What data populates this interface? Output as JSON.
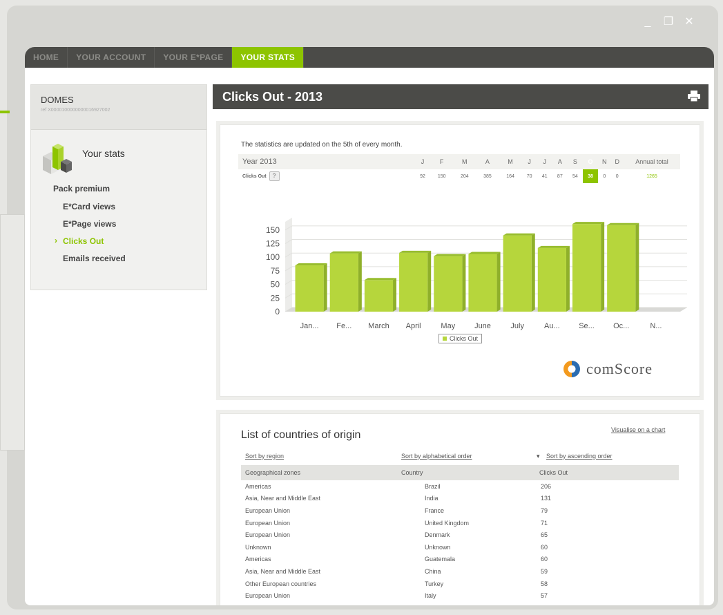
{
  "window_controls": {
    "minimize": "_",
    "restore": "❐",
    "close": "✕"
  },
  "nav": {
    "tabs": [
      {
        "label": "HOME",
        "active": false
      },
      {
        "label": "YOUR ACCOUNT",
        "active": false
      },
      {
        "label": "YOUR E*PAGE",
        "active": false
      },
      {
        "label": "YOUR STATS",
        "active": true
      }
    ]
  },
  "sidebar": {
    "name": "DOMES",
    "ref": "ref X0000100000000016927002",
    "title": "Your stats",
    "pack": "Pack premium",
    "items": [
      {
        "label": "E*Card views",
        "active": false
      },
      {
        "label": "E*Page views",
        "active": false
      },
      {
        "label": "Clicks Out",
        "active": true
      },
      {
        "label": "Emails received",
        "active": false
      }
    ]
  },
  "page_title": "Clicks Out - 2013",
  "stats": {
    "notice": "The statistics are updated on the 5th of every month.",
    "year_label": "Year 2013",
    "row_label": "Clicks Out",
    "help": "?",
    "months": [
      "J",
      "F",
      "M",
      "A",
      "M",
      "J",
      "J",
      "A",
      "S",
      "O",
      "N",
      "D"
    ],
    "annual_label": "Annual total",
    "values": [
      "92",
      "150",
      "204",
      "385",
      "164",
      "70",
      "41",
      "87",
      "54",
      "38",
      "0",
      "0"
    ],
    "annual_total": "1265",
    "highlight_index": 9
  },
  "chart_data": {
    "type": "bar",
    "categories": [
      "Jan...",
      "Fe...",
      "March",
      "April",
      "May",
      "June",
      "July",
      "Au...",
      "Se...",
      "Oc...",
      "N..."
    ],
    "series": [
      {
        "name": "Clicks Out",
        "values": [
          85,
          107,
          58,
          108,
          102,
          106,
          140,
          117,
          161,
          159,
          0
        ]
      }
    ],
    "yticks": [
      0,
      25,
      50,
      75,
      100,
      125,
      150
    ],
    "ylim": [
      0,
      165
    ],
    "legend": "Clicks Out",
    "legend_position": "bottom-center",
    "bar_color": "#b6d63c",
    "grid": true
  },
  "brand": {
    "name": "comScore"
  },
  "countries": {
    "title": "List of countries of origin",
    "viz_link": "Visualise on a chart",
    "sort_region": "Sort by region",
    "sort_alpha": "Sort by alphabetical order",
    "sort_asc": "Sort by ascending order",
    "headers": [
      "Geographical zones",
      "Country",
      "Clicks Out"
    ],
    "rows": [
      {
        "zone": "Americas",
        "country": "Brazil",
        "clicks": "206"
      },
      {
        "zone": "Asia, Near and Middle East",
        "country": "India",
        "clicks": "131"
      },
      {
        "zone": "European Union",
        "country": "France",
        "clicks": "79"
      },
      {
        "zone": "European Union",
        "country": "United Kingdom",
        "clicks": "71"
      },
      {
        "zone": "European Union",
        "country": "Denmark",
        "clicks": "65"
      },
      {
        "zone": "Unknown",
        "country": "Unknown",
        "clicks": "60"
      },
      {
        "zone": "Americas",
        "country": "Guatemala",
        "clicks": "60"
      },
      {
        "zone": "Asia, Near and Middle East",
        "country": "China",
        "clicks": "59"
      },
      {
        "zone": "Other European countries",
        "country": "Turkey",
        "clicks": "58"
      },
      {
        "zone": "European Union",
        "country": "Italy",
        "clicks": "57"
      }
    ]
  },
  "colors": {
    "accent": "#8dc400",
    "dark_bar": "#4b4b48",
    "bar_fill": "#b6d63c"
  }
}
